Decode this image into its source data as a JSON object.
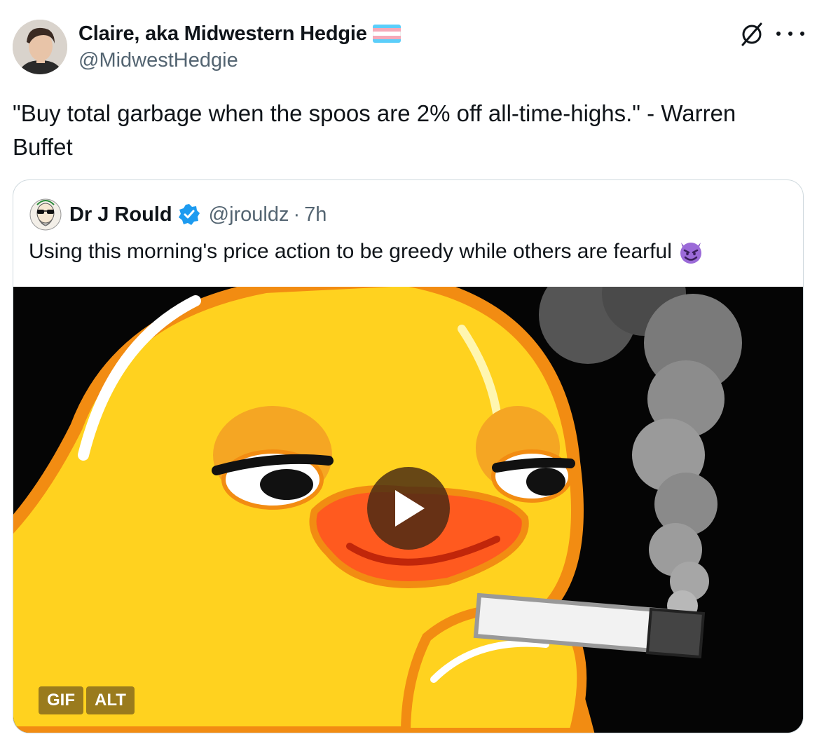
{
  "tweet": {
    "display_name": "Claire, aka Midwestern Hedgie",
    "handle": "@MidwestHedgie",
    "text": "\"Buy total garbage when the spoos are 2% off all-time-highs.\" - Warren Buffet",
    "flag_colors": [
      "#5bcefa",
      "#f5a9b8",
      "#ffffff",
      "#f5a9b8",
      "#5bcefa"
    ]
  },
  "quote": {
    "display_name": "Dr J Rould",
    "handle": "@jrouldz",
    "separator": "·",
    "time": "7h",
    "text": "Using this morning's price action to be greedy while others are fearful",
    "emoji_icon": "smiling-devil-icon",
    "media": {
      "badge_gif": "GIF",
      "badge_alt": "ALT"
    }
  },
  "colors": {
    "text_primary": "#0f1419",
    "text_secondary": "#536471",
    "verified_blue": "#1d9bf0",
    "border": "#cfd9de"
  }
}
